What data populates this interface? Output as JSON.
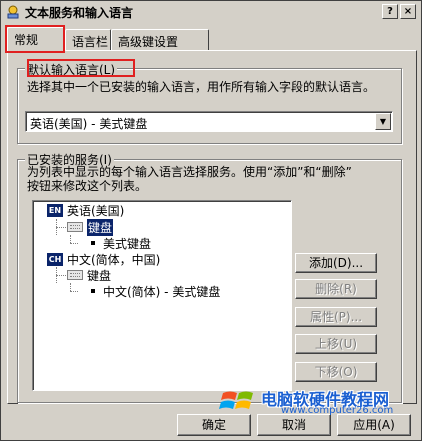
{
  "window": {
    "title": "文本服务和输入语言",
    "help_glyph": "?",
    "close_glyph": "×"
  },
  "tabs": [
    {
      "label": "常规",
      "active": true
    },
    {
      "label": "语言栏",
      "active": false
    },
    {
      "label": "高级键设置",
      "active": false
    }
  ],
  "default_language": {
    "group_title": "默认输入语言(L)",
    "description": "选择其中一个已安装的输入语言，用作所有输入字段的默认语言。",
    "selected_value": "英语(美国) - 美式键盘",
    "arrow_glyph": "▼"
  },
  "installed_services": {
    "group_title": "已安装的服务(I)",
    "description_line1": "为列表中显示的每个输入语言选择服务。使用“添加”和“删除”",
    "description_line2": "按钮来修改这个列表。",
    "tree": {
      "english": {
        "badge": "EN",
        "language": "英语(美国)",
        "category": "键盘",
        "service": "美式键盘"
      },
      "chinese": {
        "badge": "CH",
        "language": "中文(简体，中国)",
        "category": "键盘",
        "service": "中文(简体) - 美式键盘"
      }
    },
    "buttons": {
      "add": "添加(D)...",
      "remove": "删除(R)",
      "properties": "属性(P)...",
      "move_up": "上移(U)",
      "move_down": "下移(O)"
    }
  },
  "footer": {
    "ok": "确定",
    "cancel": "取消",
    "apply": "应用(A)"
  },
  "watermark": {
    "main_text": "电脑软硬件教程网",
    "url": "www.computer26.com"
  },
  "colors": {
    "selection": "#0a246a",
    "highlight_box": "#e02020",
    "watermark": "#1a5fd1"
  }
}
